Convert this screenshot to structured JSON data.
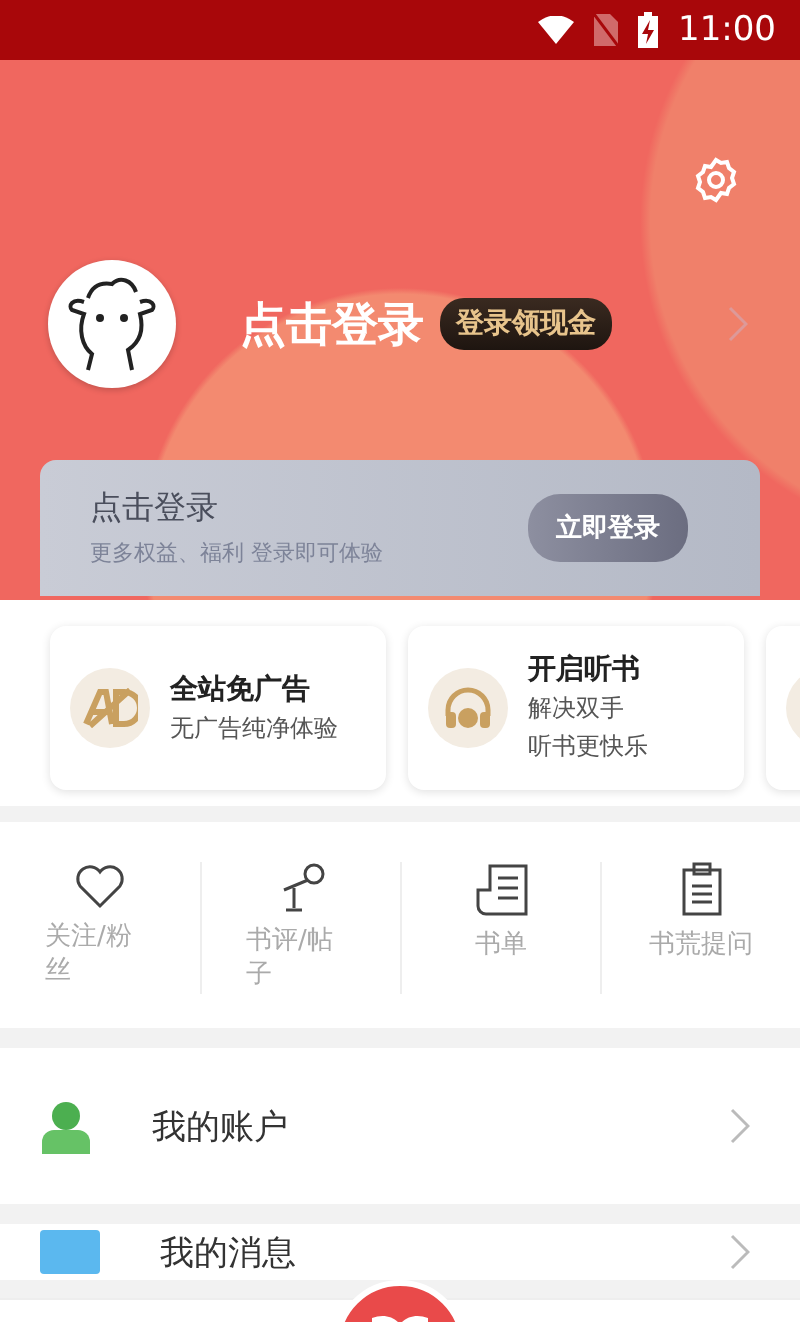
{
  "status_bar": {
    "time": "11:00"
  },
  "header": {
    "title": "点击登录",
    "badge": "登录领现金"
  },
  "login_card": {
    "title": "点击登录",
    "subtitle": "更多权益、福利 登录即可体验",
    "button": "立即登录"
  },
  "features": [
    {
      "kind": "ad",
      "title": "全站免广告",
      "lines": [
        "无广告纯净体验"
      ]
    },
    {
      "kind": "audio",
      "title": "开启听书",
      "lines": [
        "解决双手",
        "听书更快乐"
      ]
    }
  ],
  "shortcuts": [
    {
      "kind": "heart",
      "label": "关注/粉丝"
    },
    {
      "kind": "mic",
      "label": "书评/帖子"
    },
    {
      "kind": "list",
      "label": "书单"
    },
    {
      "kind": "clipboard",
      "label": "书荒提问"
    }
  ],
  "menu": [
    {
      "kind": "account",
      "label": "我的账户"
    },
    {
      "kind": "message",
      "label": "我的消息"
    }
  ]
}
